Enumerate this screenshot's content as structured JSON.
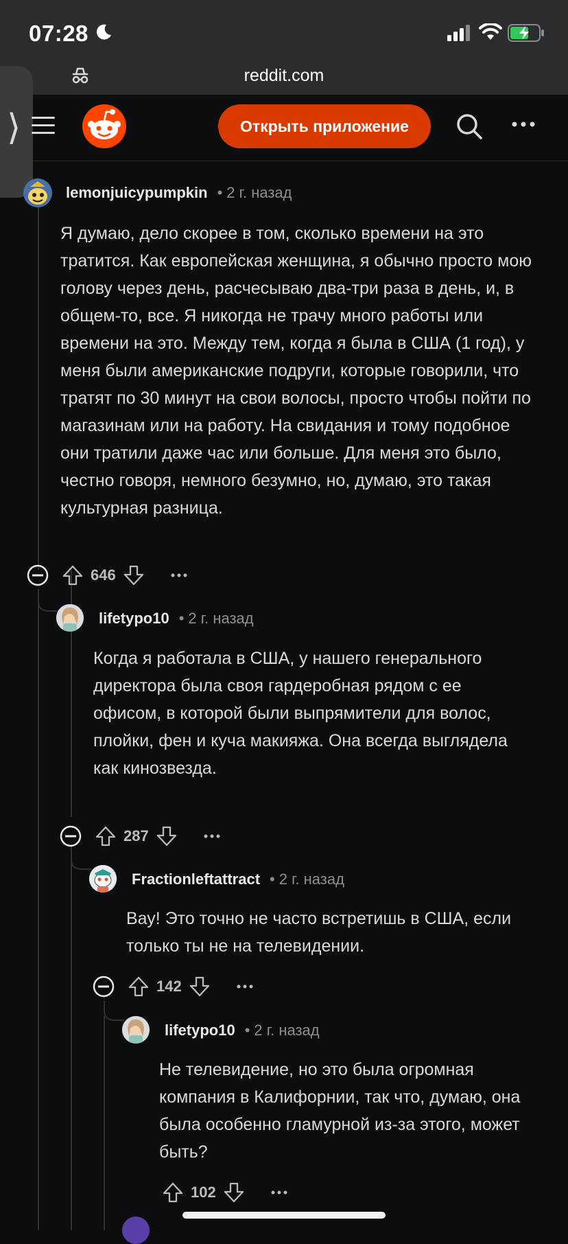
{
  "status_bar": {
    "time": "07:28"
  },
  "browser": {
    "url": "reddit.com"
  },
  "header": {
    "open_app_label": "Открыть приложение"
  },
  "comments": [
    {
      "author": "lemonjuicypumpkin",
      "age": "2 г. назад",
      "text": "Я думаю, дело скорее в том, сколько времени на это тратится. Как европейская женщина, я обычно просто мою голову через день, расчесываю два-три раза в день, и, в общем-то, все. Я никогда не трачу много работы или времени на это. Между тем, когда я была в США (1 год), у меня были американские подруги, которые говорили, что тратят по 30 минут на свои волосы, просто чтобы пойти по магазинам или на работу. На свидания и тому подобное они тратили даже час или больше. Для меня это было, честно говоря, немного безумно, но, думаю, это такая культурная разница.",
      "score": "646"
    },
    {
      "author": "lifetypo10",
      "age": "2 г. назад",
      "text": "Когда я работала в США, у нашего генерального директора была своя гардеробная рядом с ее офисом, в которой были выпрямители для волос, плойки, фен и куча макияжа. Она всегда выглядела как кинозвезда.",
      "score": "287"
    },
    {
      "author": "Fractionleftattract",
      "age": "2 г. назад",
      "text": "Вау! Это точно не часто встретишь в США, если только ты не на телевидении.",
      "score": "142"
    },
    {
      "author": "lifetypo10",
      "age": "2 г. назад",
      "text": "Не телевидение, но это была огромная компания в Калифорнии, так что, думаю, она была особенно гламурной из-за этого, может быть?",
      "score": "102"
    }
  ],
  "dot_separator": "•",
  "colors": {
    "accent": "#d93a00",
    "background": "#0b0d0e",
    "text": "#d7dadc",
    "muted": "#8b9095"
  }
}
